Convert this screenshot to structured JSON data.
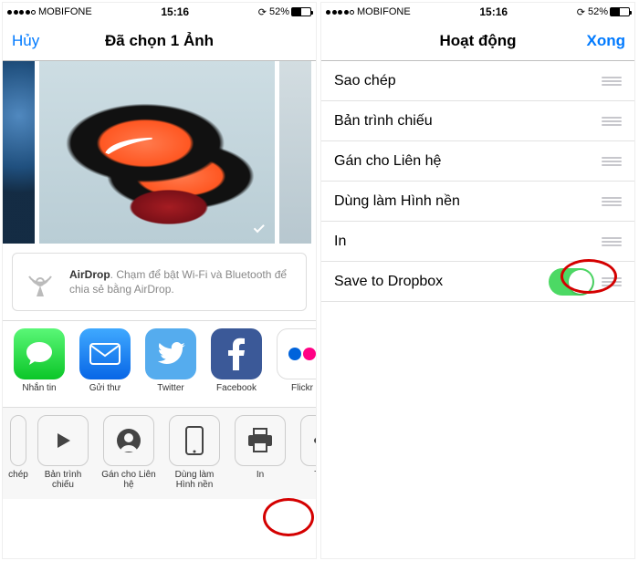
{
  "status": {
    "carrier": "MOBIFONE",
    "time": "15:16",
    "battery_text": "52%"
  },
  "left": {
    "nav_cancel": "Hủy",
    "nav_title": "Đã chọn 1 Ảnh",
    "airdrop_title": "AirDrop",
    "airdrop_body": ". Chạm để bật Wi-Fi và Bluetooth để chia sẻ bằng AirDrop.",
    "apps": [
      {
        "label": "Nhắn tin"
      },
      {
        "label": "Gửi thư"
      },
      {
        "label": "Twitter"
      },
      {
        "label": "Facebook"
      },
      {
        "label": "Flickr"
      }
    ],
    "actions": [
      {
        "label": "chép"
      },
      {
        "label": "Bản trình chiếu"
      },
      {
        "label": "Gán cho Liên hệ"
      },
      {
        "label": "Dùng làm Hình nền"
      },
      {
        "label": "In"
      },
      {
        "label": "Thêm"
      }
    ]
  },
  "right": {
    "nav_title": "Hoạt động",
    "nav_done": "Xong",
    "rows": [
      {
        "label": "Sao chép"
      },
      {
        "label": "Bản trình chiếu"
      },
      {
        "label": "Gán cho Liên hệ"
      },
      {
        "label": "Dùng làm Hình nền"
      },
      {
        "label": "In"
      },
      {
        "label": "Save to Dropbox"
      }
    ]
  }
}
